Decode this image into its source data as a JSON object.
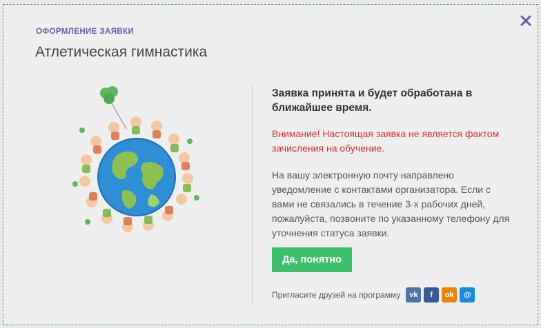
{
  "modal": {
    "kicker": "ОФОРМЛЕНИЕ ЗАЯВКИ",
    "title": "Атлетическая гимнастика",
    "close_icon": "close-icon",
    "accent": "#6a5aa8"
  },
  "confirmation": {
    "headline": "Заявка принята и будет обработана в ближайшее время.",
    "warning": "Внимание! Настоящая заявка не является фактом зачисления на обучение.",
    "info": "На вашу электронную почту направлено уведомление с контактами организатора. Если с вами не связались в течение 3-х рабочих дней, пожалуйста, позвоните по указанному телефону для уточнения статуса заявки.",
    "button_label": "Да, понятно",
    "button_color": "#3ac16a",
    "warning_color": "#d62f2f"
  },
  "share": {
    "label": "Пригласите друзей на программу",
    "networks": [
      {
        "icon": "vk-icon",
        "glyph": "vk",
        "color": "#4a76a8"
      },
      {
        "icon": "facebook-icon",
        "glyph": "f",
        "color": "#3b5998"
      },
      {
        "icon": "odnoklassniki-icon",
        "glyph": "ok",
        "color": "#ee8208"
      },
      {
        "icon": "moimir-icon",
        "glyph": "@",
        "color": "#168de2"
      }
    ]
  },
  "illustration": {
    "icon": "globe-children-illustration"
  }
}
